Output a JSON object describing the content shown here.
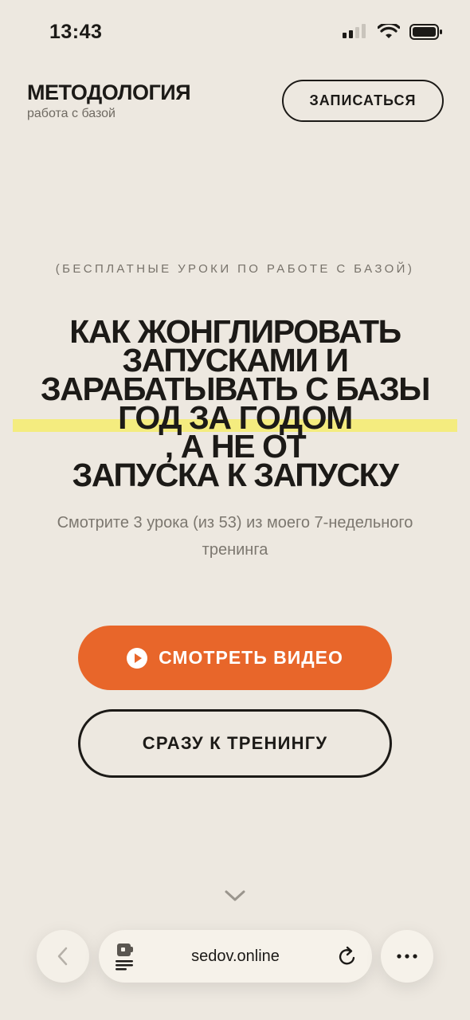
{
  "status_bar": {
    "time": "13:43",
    "icons": [
      "cellular-signal-icon",
      "wifi-icon",
      "battery-icon"
    ]
  },
  "header": {
    "brand_title": "МЕТОДОЛОГИЯ",
    "brand_subtitle": "работа с базой",
    "signup_label": "ЗАПИСАТЬСЯ"
  },
  "hero": {
    "eyebrow": "(БЕСПЛАТНЫЕ УРОКИ ПО РАБОТЕ С БАЗОЙ)",
    "headline": {
      "line1": "КАК ЖОНГЛИРОВАТЬ",
      "line2": "ЗАПУСКАМИ И",
      "line3": "ЗАРАБАТЫВАТЬ С БАЗЫ",
      "line4_highlight": "ГОД ЗА ГОДОМ",
      "line4_rest": ", А НЕ ОТ",
      "line5": "ЗАПУСКА К ЗАПУСКУ"
    },
    "subtitle": "Смотрите 3 урока (из 53) из моего 7-недельного тренинга"
  },
  "cta": {
    "primary_label": "СМОТРЕТЬ ВИДЕО",
    "primary_icon": "play-icon",
    "secondary_label": "СРАЗУ К ТРЕНИНГУ"
  },
  "scroll_hint_icon": "chevron-down-icon",
  "browser": {
    "url": "sedov.online",
    "back_icon": "chevron-left-icon",
    "tab_icon": "page-menu-icon",
    "reload_icon": "reload-icon",
    "more_icon": "more-dots-icon"
  },
  "colors": {
    "background": "#EDE8E0",
    "accent": "#E8662A",
    "highlight": "#F4EC6D",
    "text": "#1C1A17"
  }
}
